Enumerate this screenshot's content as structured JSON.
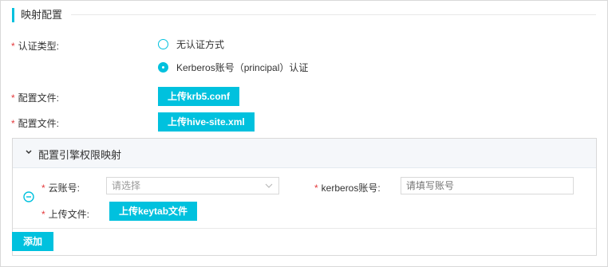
{
  "section": {
    "title": "映射配置"
  },
  "auth": {
    "label": "认证类型:",
    "options": [
      {
        "label": "无认证方式",
        "selected": false
      },
      {
        "label": "Kerberos账号（principal）认证",
        "selected": true
      }
    ]
  },
  "config_files": [
    {
      "label": "配置文件:",
      "button": "上传krb5.conf"
    },
    {
      "label": "配置文件:",
      "button": "上传hive-site.xml"
    }
  ],
  "mapping_panel": {
    "title": "配置引擎权限映射",
    "cloud_account": {
      "label": "云账号:",
      "placeholder": "请选择"
    },
    "kerberos_account": {
      "label": "kerberos账号:",
      "placeholder": "请填写账号"
    },
    "upload_file": {
      "label": "上传文件:",
      "button": "上传keytab文件"
    },
    "add_button": "添加"
  },
  "required_mark": "*",
  "colors": {
    "accent": "#00c1de",
    "required": "#e4393c"
  },
  "icons": [
    "chevron-down-icon",
    "remove-circle-icon",
    "select-arrow-icon"
  ]
}
